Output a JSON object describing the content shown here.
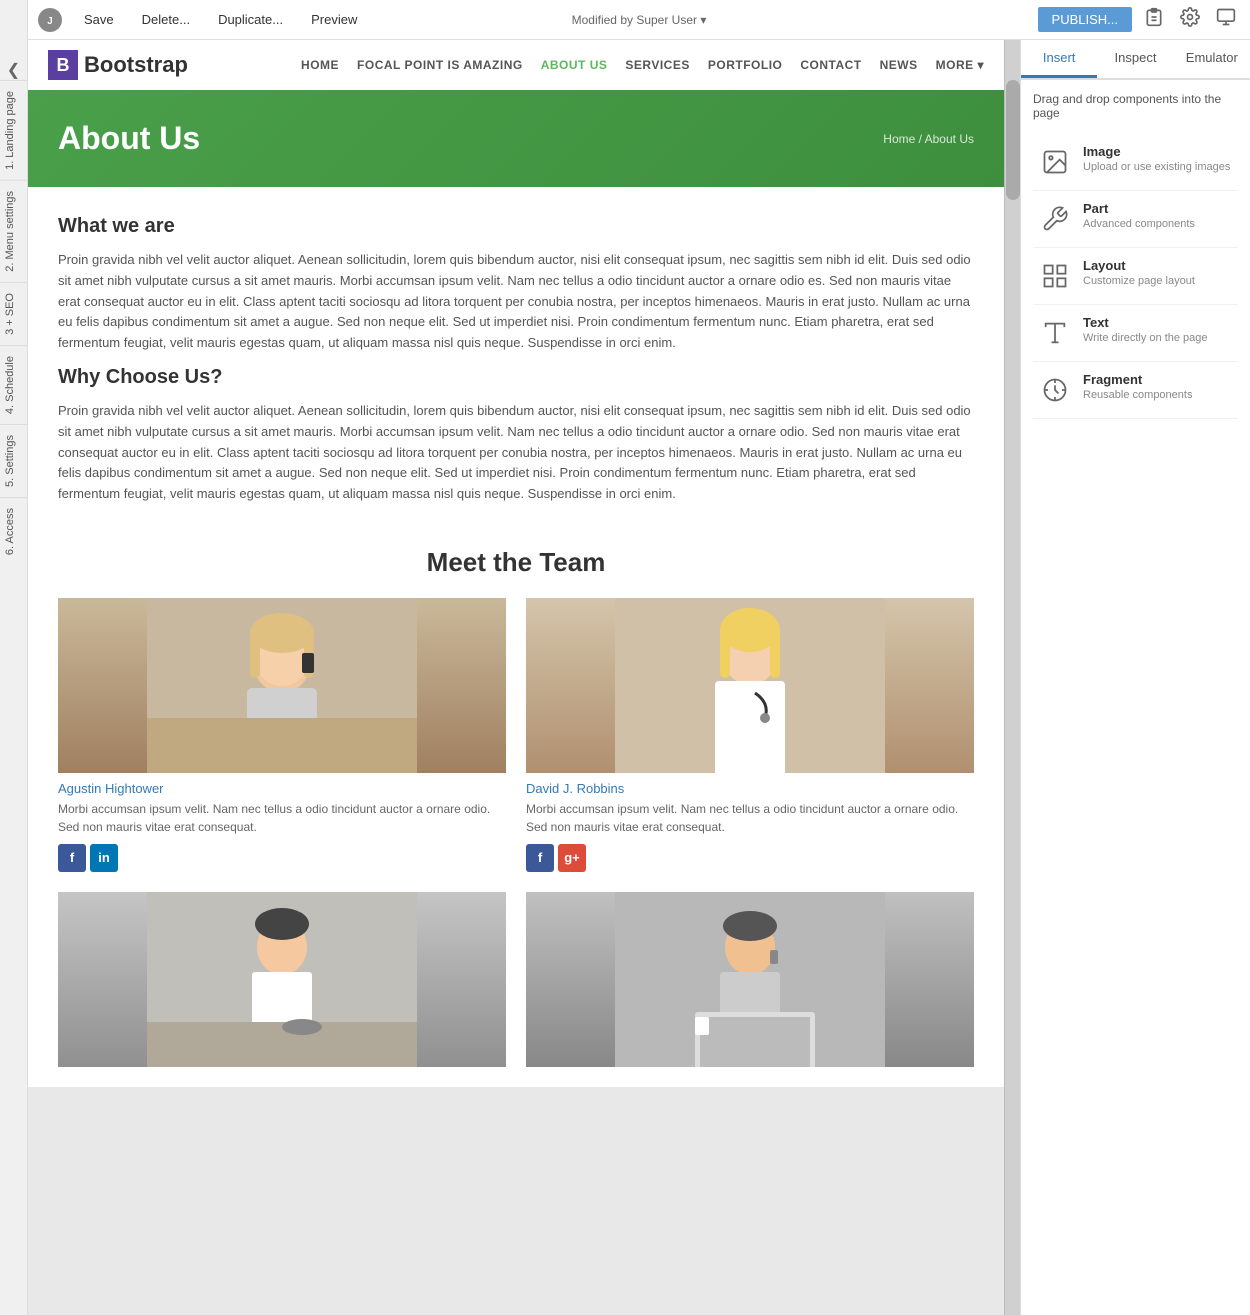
{
  "toolbar": {
    "save_label": "Save",
    "delete_label": "Delete...",
    "duplicate_label": "Duplicate...",
    "preview_label": "Preview",
    "modified_text": "Modified",
    "modified_by": "by Super User",
    "publish_label": "PUBLISH...",
    "cursor_icon": "▾"
  },
  "left_sidebar": {
    "collapse_icon": "❮",
    "tabs": [
      {
        "id": "landing",
        "label": "1. Landing page"
      },
      {
        "id": "menu",
        "label": "2. Menu settings"
      },
      {
        "id": "seo",
        "label": "3 + SEO"
      },
      {
        "id": "schedule",
        "label": "4. Schedule"
      },
      {
        "id": "settings",
        "label": "5. Settings"
      },
      {
        "id": "access",
        "label": "6. Access"
      }
    ]
  },
  "right_panel": {
    "tabs": [
      {
        "id": "insert",
        "label": "Insert",
        "active": true
      },
      {
        "id": "inspect",
        "label": "Inspect"
      },
      {
        "id": "emulator",
        "label": "Emulator"
      }
    ],
    "drag_hint": "Drag and drop components into the page",
    "components": [
      {
        "id": "image",
        "title": "Image",
        "desc": "Upload or use existing images",
        "icon_type": "image"
      },
      {
        "id": "part",
        "title": "Part",
        "desc": "Advanced components",
        "icon_type": "part"
      },
      {
        "id": "layout",
        "title": "Layout",
        "desc": "Customize page layout",
        "icon_type": "layout"
      },
      {
        "id": "text",
        "title": "Text",
        "desc": "Write directly on the page",
        "icon_type": "text"
      },
      {
        "id": "fragment",
        "title": "Fragment",
        "desc": "Reusable components",
        "icon_type": "fragment"
      }
    ]
  },
  "site": {
    "nav": {
      "logo_letter": "B",
      "logo_name": "Bootstrap",
      "links": [
        {
          "label": "HOME",
          "active": false
        },
        {
          "label": "FOCAL POINT IS AMAZING",
          "active": false
        },
        {
          "label": "ABOUT US",
          "active": true
        },
        {
          "label": "SERVICES",
          "active": false
        },
        {
          "label": "PORTFOLIO",
          "active": false
        },
        {
          "label": "CONTACT",
          "active": false
        },
        {
          "label": "NEWS",
          "active": false
        },
        {
          "label": "MORE",
          "active": false,
          "dropdown": true
        }
      ]
    },
    "hero": {
      "title": "About Us",
      "breadcrumb": "Home / About Us"
    },
    "article": {
      "section1_title": "What we are",
      "section1_p1": "Proin gravida nibh vel velit auctor aliquet. Aenean sollicitudin, lorem quis bibendum auctor, nisi elit consequat ipsum, nec sagittis sem nibh id elit. Duis sed odio sit amet nibh vulputate cursus a sit amet mauris. Morbi accumsan ipsum velit. Nam nec tellus a odio tincidunt auctor a ornare odio es. Sed non mauris vitae erat consequat auctor eu in elit. Class aptent taciti sociosqu ad litora torquent per conubia nostra, per inceptos himenaeos. Mauris in erat justo. Nullam ac urna eu felis dapibus condimentum sit amet a augue. Sed non neque elit. Sed ut imperdiet nisi. Proin condimentum fermentum nunc. Etiam pharetra, erat sed fermentum feugiat, velit mauris egestas quam, ut aliquam massa nisl quis neque. Suspendisse in orci enim.",
      "section2_title": "Why Choose Us?",
      "section2_p1": "Proin gravida nibh vel velit auctor aliquet. Aenean sollicitudin, lorem quis bibendum auctor, nisi elit consequat ipsum, nec sagittis sem nibh id elit. Duis sed odio sit amet nibh vulputate cursus a sit amet mauris. Morbi accumsan ipsum velit. Nam nec tellus a odio tincidunt auctor a ornare odio. Sed non mauris vitae erat consequat auctor eu in elit. Class aptent taciti sociosqu ad litora torquent per conubia nostra, per inceptos himenaeos. Mauris in erat justo. Nullam ac urna eu felis dapibus condimentum sit amet a augue. Sed non neque elit. Sed ut imperdiet nisi. Proin condimentum fermentum nunc. Etiam pharetra, erat sed fermentum feugiat, velit mauris egestas quam, ut aliquam massa nisl quis neque. Suspendisse in orci enim."
    },
    "team": {
      "title": "Meet the Team",
      "members": [
        {
          "name": "Agustin Hightower",
          "bio": "Morbi accumsan ipsum velit. Nam nec tellus a odio tincidunt auctor a ornare odio. Sed non mauris vitae erat consequat.",
          "social": [
            "fb",
            "li"
          ],
          "photo_type": "woman1"
        },
        {
          "name": "David J. Robbins",
          "bio": "Morbi accumsan ipsum velit. Nam nec tellus a odio tincidunt auctor a ornare odio. Sed non mauris vitae erat consequat.",
          "social": [
            "fb",
            "gp"
          ],
          "photo_type": "woman2"
        },
        {
          "name": "",
          "bio": "",
          "social": [],
          "photo_type": "man1"
        },
        {
          "name": "",
          "bio": "",
          "social": [],
          "photo_type": "man2"
        }
      ]
    }
  }
}
